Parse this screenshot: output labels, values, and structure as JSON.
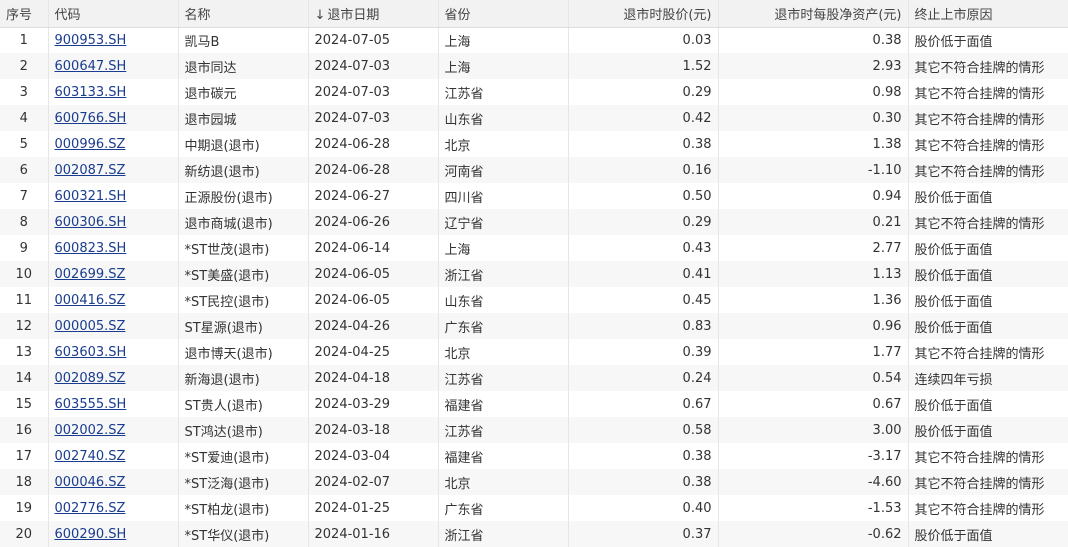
{
  "headers": {
    "idx": "序号",
    "code": "代码",
    "name": "名称",
    "date": "退市日期",
    "sort_icon": "↓",
    "province": "省份",
    "price": "退市时股价(元)",
    "nav": "退市时每股净资产(元)",
    "reason": "终止上市原因"
  },
  "rows": [
    {
      "idx": "1",
      "code": "900953.SH",
      "name": "凯马B",
      "date": "2024-07-05",
      "province": "上海",
      "price": "0.03",
      "nav": "0.38",
      "reason": "股价低于面值"
    },
    {
      "idx": "2",
      "code": "600647.SH",
      "name": "退市同达",
      "date": "2024-07-03",
      "province": "上海",
      "price": "1.52",
      "nav": "2.93",
      "reason": "其它不符合挂牌的情形"
    },
    {
      "idx": "3",
      "code": "603133.SH",
      "name": "退市碳元",
      "date": "2024-07-03",
      "province": "江苏省",
      "price": "0.29",
      "nav": "0.98",
      "reason": "其它不符合挂牌的情形"
    },
    {
      "idx": "4",
      "code": "600766.SH",
      "name": "退市园城",
      "date": "2024-07-03",
      "province": "山东省",
      "price": "0.42",
      "nav": "0.30",
      "reason": "其它不符合挂牌的情形"
    },
    {
      "idx": "5",
      "code": "000996.SZ",
      "name": "中期退(退市)",
      "date": "2024-06-28",
      "province": "北京",
      "price": "0.38",
      "nav": "1.38",
      "reason": "其它不符合挂牌的情形"
    },
    {
      "idx": "6",
      "code": "002087.SZ",
      "name": "新纺退(退市)",
      "date": "2024-06-28",
      "province": "河南省",
      "price": "0.16",
      "nav": "-1.10",
      "reason": "其它不符合挂牌的情形"
    },
    {
      "idx": "7",
      "code": "600321.SH",
      "name": "正源股份(退市)",
      "date": "2024-06-27",
      "province": "四川省",
      "price": "0.50",
      "nav": "0.94",
      "reason": "股价低于面值"
    },
    {
      "idx": "8",
      "code": "600306.SH",
      "name": "退市商城(退市)",
      "date": "2024-06-26",
      "province": "辽宁省",
      "price": "0.29",
      "nav": "0.21",
      "reason": "其它不符合挂牌的情形"
    },
    {
      "idx": "9",
      "code": "600823.SH",
      "name": "*ST世茂(退市)",
      "date": "2024-06-14",
      "province": "上海",
      "price": "0.43",
      "nav": "2.77",
      "reason": "股价低于面值"
    },
    {
      "idx": "10",
      "code": "002699.SZ",
      "name": "*ST美盛(退市)",
      "date": "2024-06-05",
      "province": "浙江省",
      "price": "0.41",
      "nav": "1.13",
      "reason": "股价低于面值"
    },
    {
      "idx": "11",
      "code": "000416.SZ",
      "name": "*ST民控(退市)",
      "date": "2024-06-05",
      "province": "山东省",
      "price": "0.45",
      "nav": "1.36",
      "reason": "股价低于面值"
    },
    {
      "idx": "12",
      "code": "000005.SZ",
      "name": "ST星源(退市)",
      "date": "2024-04-26",
      "province": "广东省",
      "price": "0.83",
      "nav": "0.96",
      "reason": "股价低于面值"
    },
    {
      "idx": "13",
      "code": "603603.SH",
      "name": "退市博天(退市)",
      "date": "2024-04-25",
      "province": "北京",
      "price": "0.39",
      "nav": "1.77",
      "reason": "其它不符合挂牌的情形"
    },
    {
      "idx": "14",
      "code": "002089.SZ",
      "name": "新海退(退市)",
      "date": "2024-04-18",
      "province": "江苏省",
      "price": "0.24",
      "nav": "0.54",
      "reason": "连续四年亏损"
    },
    {
      "idx": "15",
      "code": "603555.SH",
      "name": "ST贵人(退市)",
      "date": "2024-03-29",
      "province": "福建省",
      "price": "0.67",
      "nav": "0.67",
      "reason": "股价低于面值"
    },
    {
      "idx": "16",
      "code": "002002.SZ",
      "name": "ST鸿达(退市)",
      "date": "2024-03-18",
      "province": "江苏省",
      "price": "0.58",
      "nav": "3.00",
      "reason": "股价低于面值"
    },
    {
      "idx": "17",
      "code": "002740.SZ",
      "name": "*ST爱迪(退市)",
      "date": "2024-03-04",
      "province": "福建省",
      "price": "0.38",
      "nav": "-3.17",
      "reason": "其它不符合挂牌的情形"
    },
    {
      "idx": "18",
      "code": "000046.SZ",
      "name": "*ST泛海(退市)",
      "date": "2024-02-07",
      "province": "北京",
      "price": "0.38",
      "nav": "-4.60",
      "reason": "其它不符合挂牌的情形"
    },
    {
      "idx": "19",
      "code": "002776.SZ",
      "name": "*ST柏龙(退市)",
      "date": "2024-01-25",
      "province": "广东省",
      "price": "0.40",
      "nav": "-1.53",
      "reason": "其它不符合挂牌的情形"
    },
    {
      "idx": "20",
      "code": "600290.SH",
      "name": "*ST华仪(退市)",
      "date": "2024-01-16",
      "province": "浙江省",
      "price": "0.37",
      "nav": "-0.62",
      "reason": "股价低于面值"
    }
  ]
}
